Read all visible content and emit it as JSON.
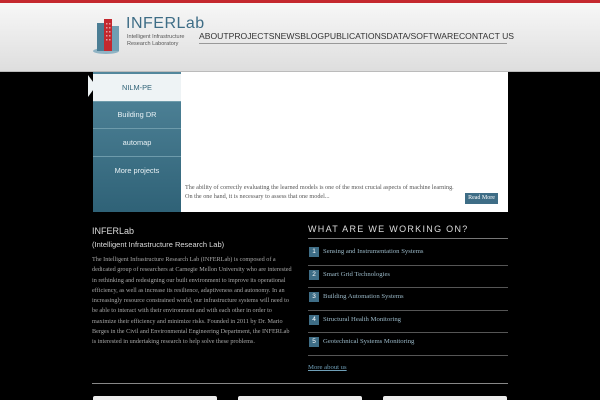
{
  "header": {
    "logo_name": "INFERLab",
    "logo_tagline_1": "Intelligent Infrastructure",
    "logo_tagline_2": "Research Laboratory",
    "nav": [
      "ABOUT",
      "PROJECTS",
      "NEWS",
      "BLOG",
      "PUBLICATIONS",
      "DATA/SOFTWARE",
      "CONTACT US"
    ]
  },
  "slider": {
    "tabs": [
      "NILM-PE",
      "Building DR",
      "automap",
      "More projects"
    ],
    "active_index": 0,
    "caption": "The ability of correctly evaluating the learned models is one of the most crucial aspects of machine learning. On the one hand, it is necessary to assess that one model...",
    "read_more": "Read More"
  },
  "about": {
    "title": "INFERLab",
    "subtitle": "(Intelligent Infrastructure Research Lab)",
    "text": "The Intelligent Infrastructure Research Lab (INFERLab) is composed of a dedicated group of researchers at Carnegie Mellon University who are interested in rethinking and redesigning our built environment to improve its operational efficiency, as well as increase its resilience, adaptiveness and autonomy. In an increasingly resource constrained world, our infrastructure systems will need to be able to interact with their environment and with each other in order to maximize their efficiency and minimize risks. Founded in 2011 by Dr. Mario Berges in the Civil and Environmental Engineering Department, the INFERLab is interested in undertaking research to help solve these problems."
  },
  "working_on": {
    "title": "WHAT ARE WE WORKING ON?",
    "items": [
      {
        "num": "1",
        "label": "Sensing and Instrumentation Systems"
      },
      {
        "num": "2",
        "label": "Smart Grid Technologies"
      },
      {
        "num": "3",
        "label": "Building Automation Systems"
      },
      {
        "num": "4",
        "label": "Structural Health Monitoring"
      },
      {
        "num": "5",
        "label": "Geotechnical Systems Monitoring"
      }
    ],
    "more_link": "More about us"
  },
  "colors": {
    "accent": "#3e6d86",
    "brand_red": "#c4282e",
    "sidebar": "#3f7388"
  }
}
